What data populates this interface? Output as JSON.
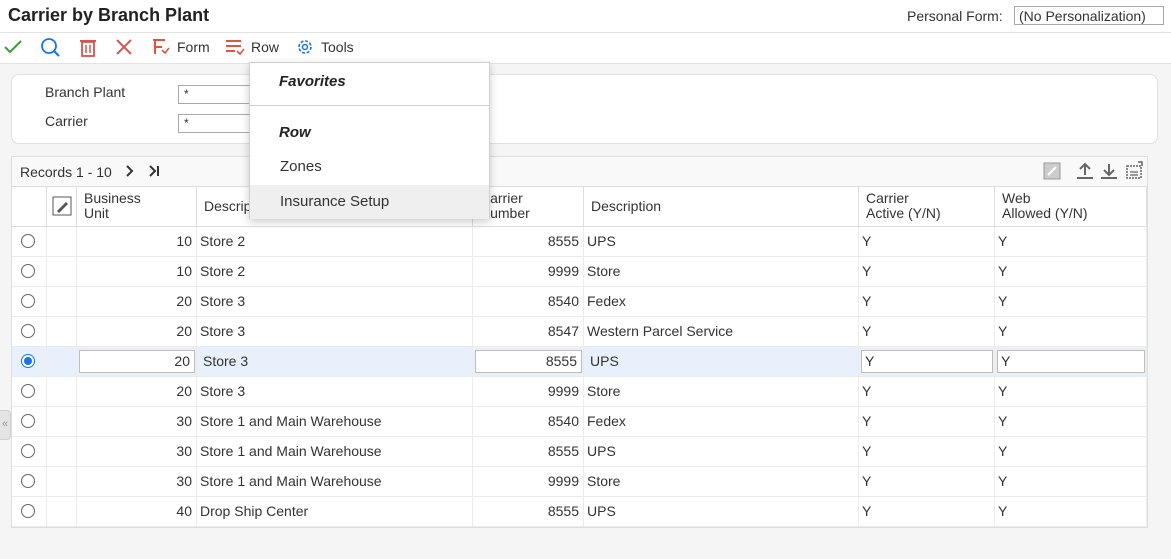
{
  "title": "Carrier by Branch Plant",
  "personal_form": {
    "label": "Personal Form:",
    "value": "(No Personalization)"
  },
  "toolbar": {
    "form_label": "Form",
    "row_label": "Row",
    "tools_label": "Tools",
    "icons": [
      "checkmark-icon",
      "search-icon",
      "delete-icon",
      "close-icon",
      "form-icon",
      "row-icon",
      "gear-icon"
    ]
  },
  "filters": {
    "branch_plant": {
      "label": "Branch Plant",
      "value": "*"
    },
    "carrier": {
      "label": "Carrier",
      "value": "*"
    }
  },
  "grid": {
    "records": "Records 1 - 10",
    "columns": [
      "Business\nUnit",
      "Description",
      "Carrier\nNumber",
      "Description",
      "Carrier\nActive (Y/N)",
      "Web\nAllowed (Y/N)"
    ],
    "rows": [
      {
        "bu": "10",
        "desc": "Store 2",
        "carrier": "8555",
        "cdesc": "UPS",
        "active": "Y",
        "web": "Y",
        "selected": false
      },
      {
        "bu": "10",
        "desc": "Store 2",
        "carrier": "9999",
        "cdesc": "Store",
        "active": "Y",
        "web": "Y",
        "selected": false
      },
      {
        "bu": "20",
        "desc": "Store 3",
        "carrier": "8540",
        "cdesc": "Fedex",
        "active": "Y",
        "web": "Y",
        "selected": false
      },
      {
        "bu": "20",
        "desc": "Store 3",
        "carrier": "8547",
        "cdesc": "Western Parcel Service",
        "active": "Y",
        "web": "Y",
        "selected": false
      },
      {
        "bu": "20",
        "desc": "Store 3",
        "carrier": "8555",
        "cdesc": "UPS",
        "active": "Y",
        "web": "Y",
        "selected": true
      },
      {
        "bu": "20",
        "desc": "Store 3",
        "carrier": "9999",
        "cdesc": "Store",
        "active": "Y",
        "web": "Y",
        "selected": false
      },
      {
        "bu": "30",
        "desc": "Store 1 and Main Warehouse",
        "carrier": "8540",
        "cdesc": "Fedex",
        "active": "Y",
        "web": "Y",
        "selected": false
      },
      {
        "bu": "30",
        "desc": "Store 1 and Main Warehouse",
        "carrier": "8555",
        "cdesc": "UPS",
        "active": "Y",
        "web": "Y",
        "selected": false
      },
      {
        "bu": "30",
        "desc": "Store 1 and Main Warehouse",
        "carrier": "9999",
        "cdesc": "Store",
        "active": "Y",
        "web": "Y",
        "selected": false
      },
      {
        "bu": "40",
        "desc": "Drop Ship Center",
        "carrier": "8555",
        "cdesc": "UPS",
        "active": "Y",
        "web": "Y",
        "selected": false
      }
    ]
  },
  "row_menu": {
    "favorites_label": "Favorites",
    "row_label": "Row",
    "items": [
      "Zones",
      "Insurance Setup"
    ]
  },
  "colors": {
    "accent": "#1a73e8",
    "delete": "#d9534f",
    "confirm": "#3c9a3c",
    "menu_icon": "#e0533f"
  }
}
